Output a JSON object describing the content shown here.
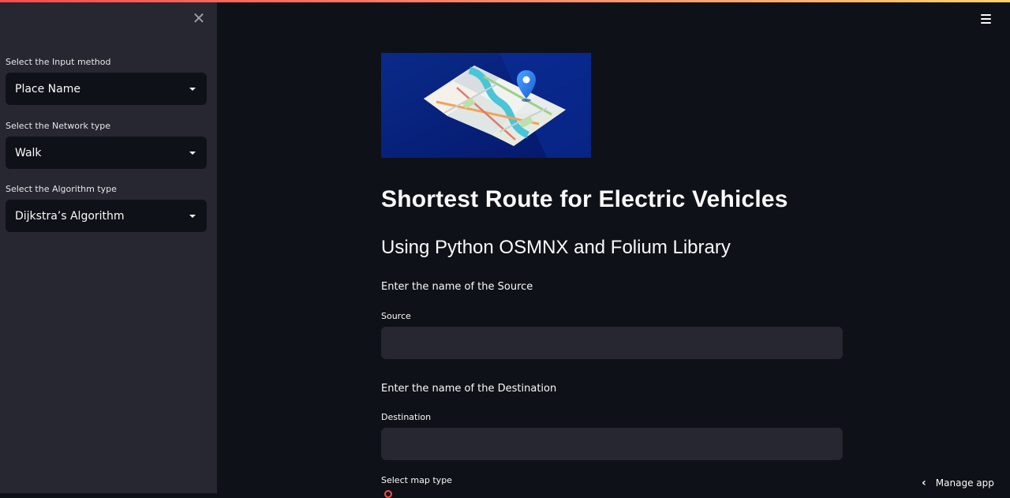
{
  "sidebar": {
    "close_icon": "close-icon",
    "fields": [
      {
        "label": "Select the Input method",
        "value": "Place Name"
      },
      {
        "label": "Select the Network type",
        "value": "Walk"
      },
      {
        "label": "Select the Algorithm type",
        "value": "Dijkstra’s Algorithm"
      }
    ]
  },
  "header": {
    "menu_icon": "hamburger-menu-icon"
  },
  "main": {
    "hero_image": "map-with-location-pin-illustration",
    "title": "Shortest Route for Electric Vehicles",
    "subtitle": "Using Python OSMNX and Folium Library",
    "source": {
      "prompt": "Enter the name of the Source",
      "label": "Source",
      "value": ""
    },
    "destination": {
      "prompt": "Enter the name of the Destination",
      "label": "Destination",
      "value": ""
    },
    "map_type_label": "Select map type"
  },
  "footer": {
    "manage_app": "Manage app"
  },
  "colors": {
    "background": "#0e1117",
    "sidebar": "#262730",
    "accent": "#ff4b4b",
    "text": "#fafafa"
  }
}
